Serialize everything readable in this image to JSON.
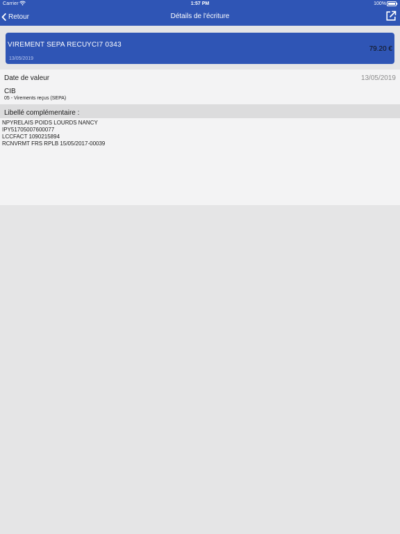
{
  "status_bar": {
    "carrier": "Carrier",
    "time": "1:57 PM",
    "battery": "100%"
  },
  "nav": {
    "back_label": "Retour",
    "title": "Détails de l'écriture",
    "back_icon": "chevron-left-icon",
    "share_icon": "external-link-icon"
  },
  "transaction": {
    "label": "VIREMENT SEPA RECU",
    "reference": "YCI7 0343",
    "date": "13/05/2019",
    "amount": "79.20 €"
  },
  "details": {
    "value_date_label": "Date de valeur",
    "value_date": "13/05/2019",
    "cib_label": "CIB",
    "cib_value": "05 - Virements reçus (SEPA)",
    "libelle_label": "Libellé complémentaire :",
    "libelle_lines": [
      "NPYRELAIS POIDS LOURDS NANCY",
      "IPY51705007600077",
      "LCCFACT 1090215894",
      "RCNVRMT FRS RPLB 15/05/2017-00039"
    ]
  },
  "colors": {
    "brand_blue": "#2f55b5",
    "background": "#e5e5e6",
    "panel": "#f3f3f4"
  }
}
